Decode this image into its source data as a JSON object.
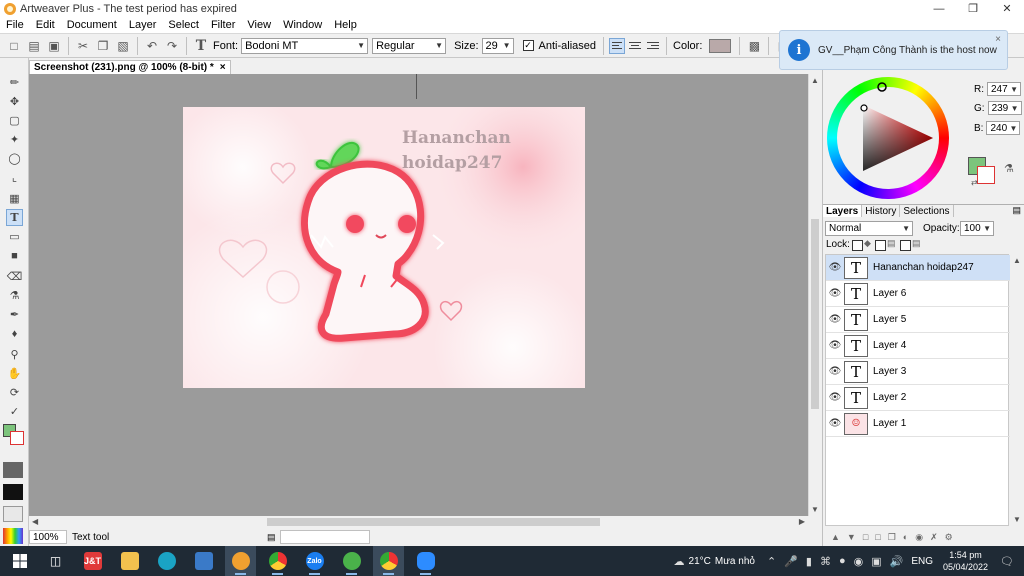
{
  "window": {
    "title": "Artweaver Plus - The test period has expired",
    "minimize": "—",
    "maximize": "❐",
    "close": "✕"
  },
  "menu": [
    "File",
    "Edit",
    "Document",
    "Layer",
    "Select",
    "Filter",
    "View",
    "Window",
    "Help"
  ],
  "options": {
    "font_label": "Font:",
    "font_value": "Bodoni MT",
    "style_value": "Regular",
    "size_label": "Size:",
    "size_value": "29",
    "antialias_label": "Anti-aliased",
    "antialias_checked": true,
    "color_label": "Color:",
    "color_value": "#b9a9a9"
  },
  "notification": {
    "message": "GV__Phạm Công Thành is the host now",
    "close": "×"
  },
  "document": {
    "tab_title": "Screenshot (231).png @ 100% (8-bit) *",
    "tab_close": "×",
    "canvas_text_line1": "Hananchan",
    "canvas_text_line2": "hoidap247"
  },
  "status": {
    "zoom": "100%",
    "tool": "Text tool"
  },
  "color_panel": {
    "r_label": "R:",
    "r": "247",
    "g_label": "G:",
    "g": "239",
    "b_label": "B:",
    "b": "240",
    "fg": "#7cc47c",
    "bg": "#ffffff"
  },
  "layers_panel": {
    "tabs": [
      "Layers",
      "History",
      "Selections"
    ],
    "blend_mode": "Normal",
    "opacity_label": "Opacity:",
    "opacity": "100",
    "lock_label": "Lock:",
    "layers": [
      {
        "name": "Hananchan hoidap247",
        "type": "text",
        "selected": true
      },
      {
        "name": "Layer 6",
        "type": "text",
        "selected": false
      },
      {
        "name": "Layer 5",
        "type": "text",
        "selected": false
      },
      {
        "name": "Layer 4",
        "type": "text",
        "selected": false
      },
      {
        "name": "Layer 3",
        "type": "text",
        "selected": false
      },
      {
        "name": "Layer 2",
        "type": "text",
        "selected": false
      },
      {
        "name": "Layer 1",
        "type": "image",
        "selected": false
      }
    ],
    "text_thumb": "T"
  },
  "taskbar": {
    "weather_temp": "21°C",
    "weather_text": "Mưa nhỏ",
    "language": "ENG",
    "time": "1:54 pm",
    "date": "05/04/2022"
  }
}
